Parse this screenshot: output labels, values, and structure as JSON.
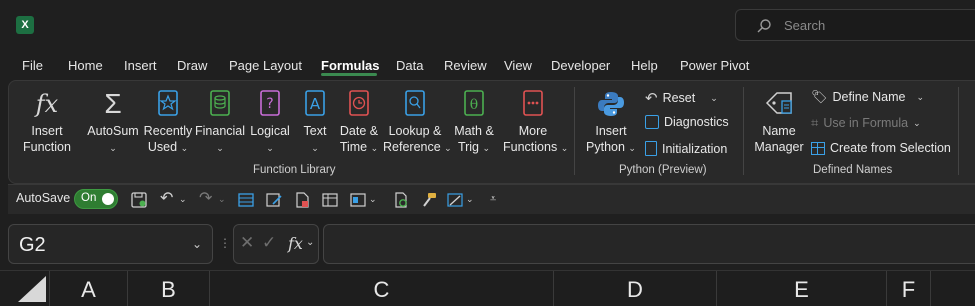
{
  "app": {
    "icon_letter": "X"
  },
  "search": {
    "placeholder": "Search"
  },
  "tabs": [
    "File",
    "Home",
    "Insert",
    "Draw",
    "Page Layout",
    "Formulas",
    "Data",
    "Review",
    "View",
    "Developer",
    "Help",
    "Power Pivot"
  ],
  "active_tab": "Formulas",
  "ribbon": {
    "function_library": {
      "insert_function": [
        "Insert",
        "Function"
      ],
      "autosum": "AutoSum",
      "recently_used": [
        "Recently",
        "Used"
      ],
      "financial": "Financial",
      "logical": "Logical",
      "text": "Text",
      "date_time": [
        "Date &",
        "Time"
      ],
      "lookup_reference": [
        "Lookup &",
        "Reference"
      ],
      "math_trig": [
        "Math &",
        "Trig"
      ],
      "more_functions": [
        "More",
        "Functions"
      ],
      "group_label": "Function Library"
    },
    "python": {
      "insert_python": [
        "Insert",
        "Python"
      ],
      "reset": "Reset",
      "diagnostics": "Diagnostics",
      "initialization": "Initialization",
      "group_label": "Python (Preview)"
    },
    "defined_names": {
      "name_manager": [
        "Name",
        "Manager"
      ],
      "define_name": "Define Name",
      "use_in_formula": "Use in Formula",
      "create_from_selection": "Create from Selection",
      "group_label": "Defined Names"
    }
  },
  "quick_access": {
    "autosave_label": "AutoSave",
    "autosave_state": "On"
  },
  "name_box": {
    "value": "G2"
  },
  "formula_bar": {
    "fx": "fx",
    "value": ""
  },
  "columns": [
    "A",
    "B",
    "C",
    "D",
    "E",
    "F"
  ],
  "colors": {
    "accent": "#3b8a50",
    "toggle_on": "#2f7d32",
    "ribbon_bg": "#292929",
    "window_bg": "#1f1f1f"
  }
}
